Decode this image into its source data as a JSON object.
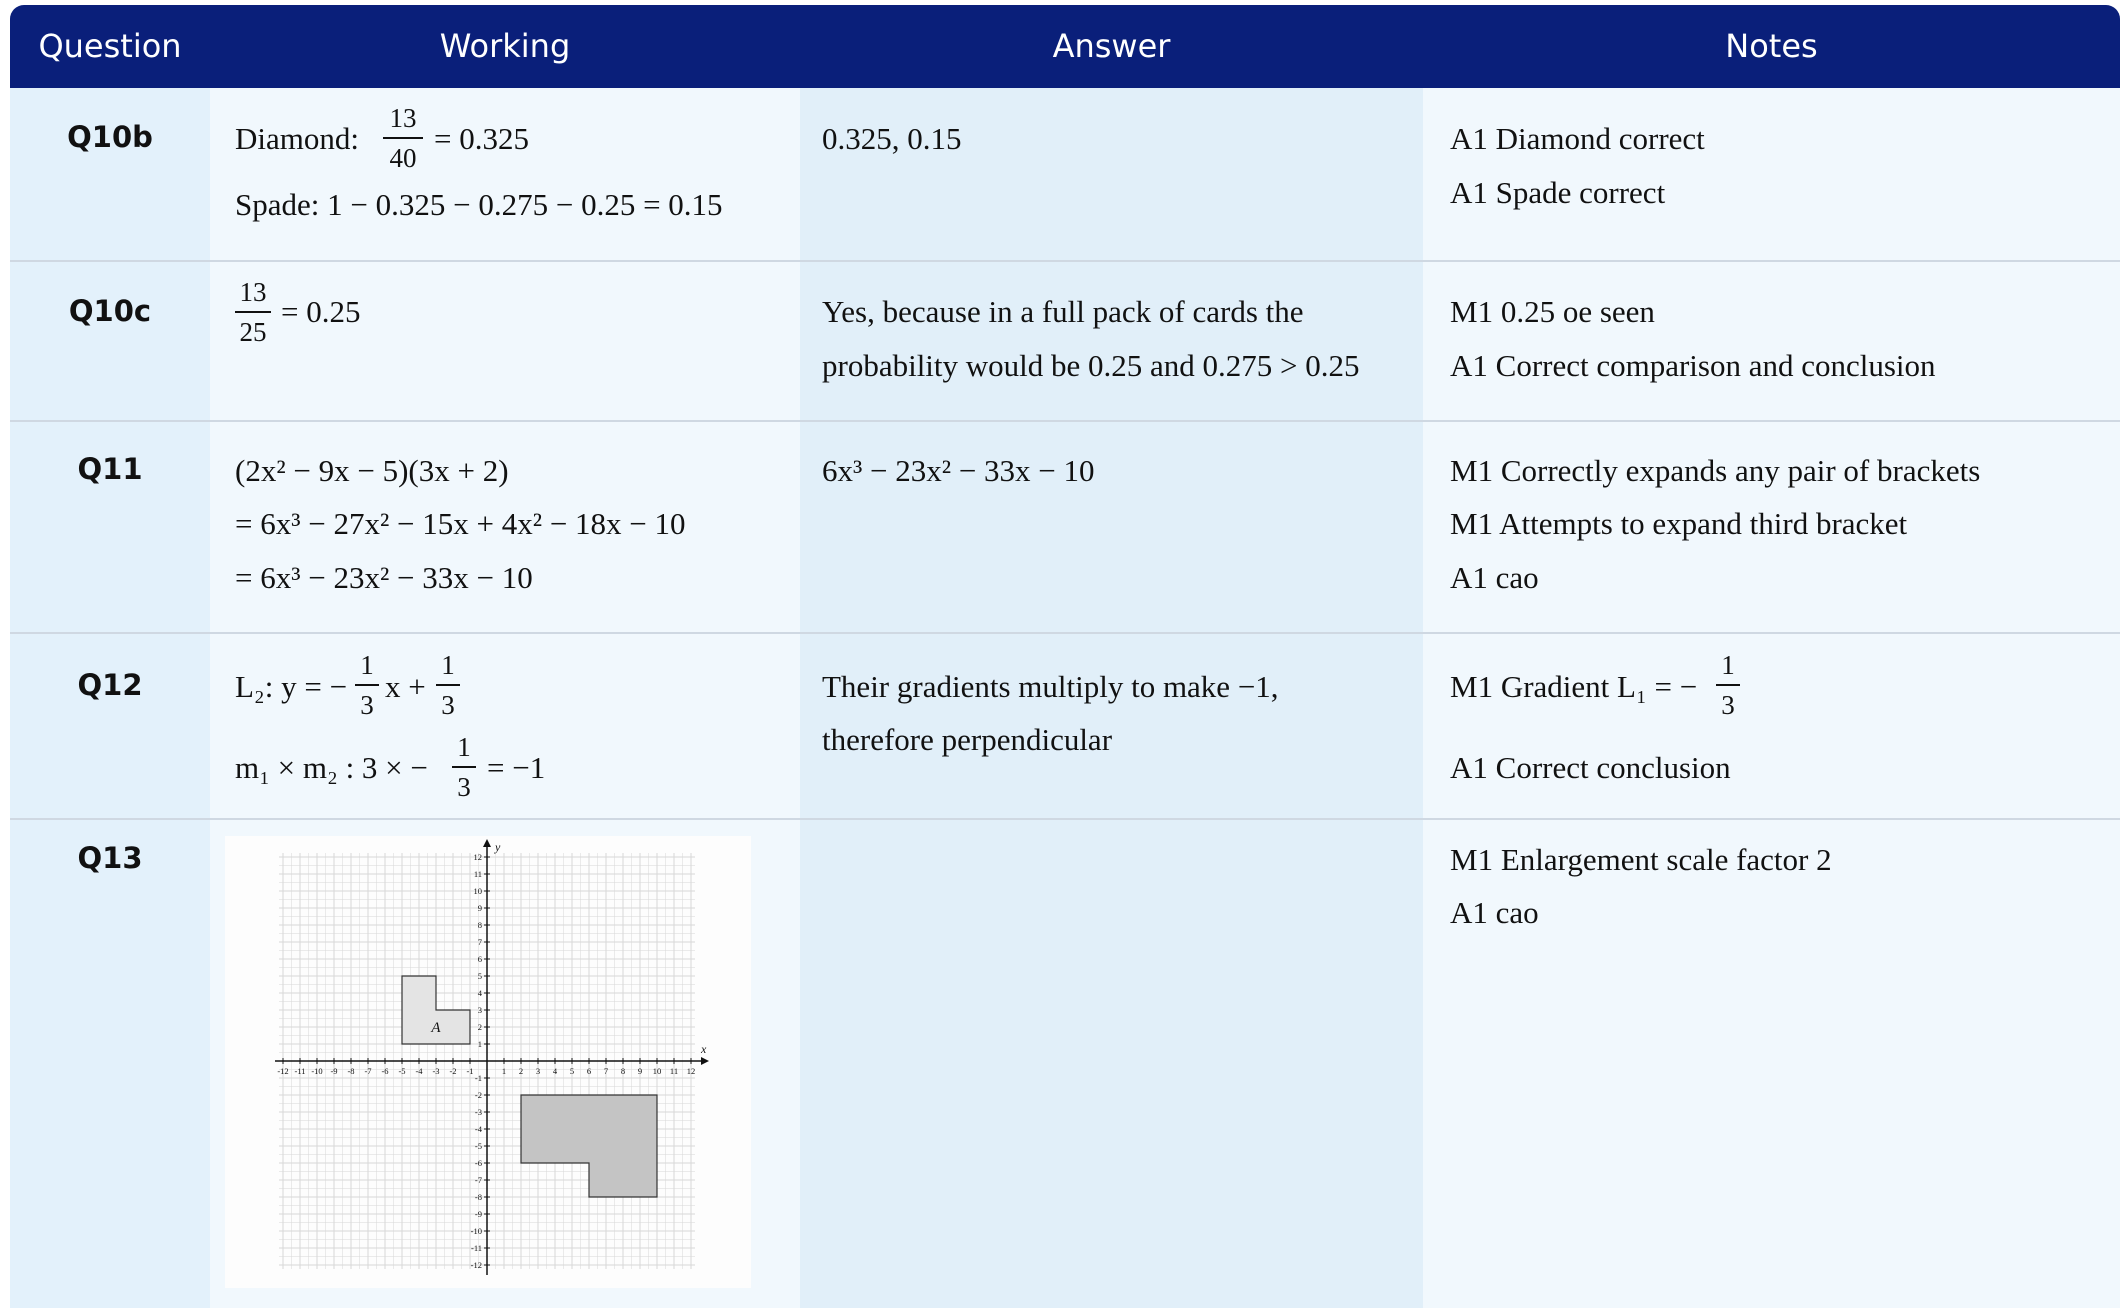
{
  "headers": {
    "question": "Question",
    "working": "Working",
    "answer": "Answer",
    "notes": "Notes"
  },
  "rows": [
    {
      "question": "Q10b",
      "working": {
        "l1_label": "Diamond:",
        "l1_num": "13",
        "l1_den": "40",
        "l1_tail": "= 0.325",
        "l2": "Spade: 1 − 0.325 − 0.275 − 0.25 = 0.15"
      },
      "answer": [
        "0.325, 0.15"
      ],
      "notes": [
        "A1 Diamond correct",
        "A1 Spade correct"
      ]
    },
    {
      "question": "Q10c",
      "working": {
        "num": "13",
        "den": "25",
        "tail": "= 0.25"
      },
      "answer": [
        "Yes, because in a full pack of cards the",
        "probability would be 0.25 and 0.275 > 0.25"
      ],
      "notes": [
        "M1 0.25 oe seen",
        "A1 Correct comparison and conclusion"
      ]
    },
    {
      "question": "Q11",
      "working": [
        "(2x² − 9x − 5)(3x + 2)",
        "= 6x³ − 27x² − 15x + 4x² − 18x − 10",
        "= 6x³ − 23x² − 33x − 10"
      ],
      "answer": [
        "6x³ − 23x² − 33x − 10"
      ],
      "notes": [
        "M1 Correctly expands any pair of brackets",
        "M1 Attempts to expand third bracket",
        "A1 cao"
      ]
    },
    {
      "question": "Q12",
      "working": {
        "l1_head": "L₂: y = −",
        "l1_num": "1",
        "l1_den": "3",
        "l1_mid": "x +",
        "l1_num2": "1",
        "l1_den2": "3",
        "l2_head": "m₁ × m₂ : 3 × −",
        "l2_num": "1",
        "l2_den": "3",
        "l2_tail": "= −1"
      },
      "answer": [
        "Their gradients multiply to make −1,",
        "therefore perpendicular"
      ],
      "notes": {
        "n1_head": "M1 Gradient L₁ = −",
        "n1_num": "1",
        "n1_den": "3",
        "n2": "A1 Correct conclusion"
      }
    },
    {
      "question": "Q13",
      "answer": [],
      "notes": [
        "M1 Enlargement scale factor 2",
        "A1 cao"
      ],
      "graph": {
        "x_label": "x",
        "y_label": "y",
        "axis_range": [
          -12,
          12
        ],
        "shape_a_label": "A",
        "shape_a_vertices": [
          [
            -5,
            1
          ],
          [
            -5,
            5
          ],
          [
            -3,
            5
          ],
          [
            -3,
            3
          ],
          [
            -1,
            3
          ],
          [
            -1,
            1
          ]
        ],
        "image_vertices": [
          [
            2,
            -2
          ],
          [
            10,
            -2
          ],
          [
            10,
            -8
          ],
          [
            6,
            -8
          ],
          [
            6,
            -6
          ],
          [
            2,
            -6
          ]
        ],
        "colors": {
          "shape_a": "#e4e4e4",
          "image": "#c4c4c4",
          "grid": "#d8d8d8",
          "axis": "#111111"
        }
      }
    }
  ]
}
